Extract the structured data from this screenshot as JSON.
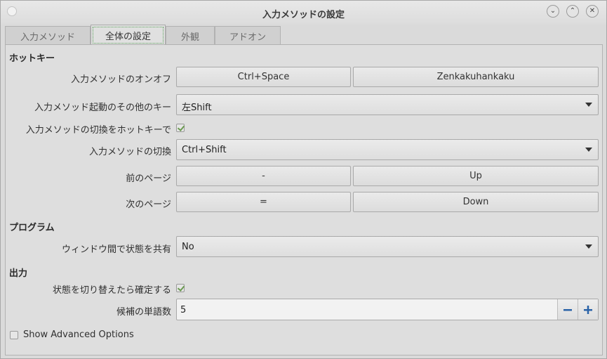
{
  "window": {
    "title": "入力メソッドの設定",
    "controls": {
      "minimize": "⌄",
      "maximize": "⌃",
      "close": "✕"
    }
  },
  "tabs": [
    {
      "label": "入力メソッド",
      "active": false
    },
    {
      "label": "全体の設定",
      "active": true
    },
    {
      "label": "外観",
      "active": false
    },
    {
      "label": "アドオン",
      "active": false
    }
  ],
  "sections": {
    "hotkey": "ホットキー",
    "program": "プログラム",
    "output": "出力"
  },
  "hotkey": {
    "toggle_label": "入力メソッドのオンオフ",
    "toggle_key1": "Ctrl+Space",
    "toggle_key2": "Zenkakuhankaku",
    "extra_label": "入力メソッド起動のその他のキー",
    "extra_value": "左Shift",
    "switch_hotkey_label": "入力メソッドの切換をホットキーで",
    "switch_hotkey_checked": true,
    "switch_label": "入力メソッドの切換",
    "switch_value": "Ctrl+Shift",
    "prev_page_label": "前のページ",
    "prev_key1": "-",
    "prev_key2": "Up",
    "next_page_label": "次のページ",
    "next_key1": "=",
    "next_key2": "Down"
  },
  "program": {
    "share_label": "ウィンドウ間で状態を共有",
    "share_value": "No"
  },
  "output": {
    "commit_label": "状態を切り替えたら確定する",
    "commit_checked": true,
    "candidates_label": "候補の単語数",
    "candidates_value": "5",
    "decrement_icon": "minus-icon",
    "increment_icon": "plus-icon"
  },
  "advanced": {
    "label": "Show Advanced Options",
    "checked": false
  },
  "colors": {
    "check_mark": "#6a9a50",
    "spin_icon": "#2a63a8",
    "tab_focus": "#5aa05a"
  }
}
